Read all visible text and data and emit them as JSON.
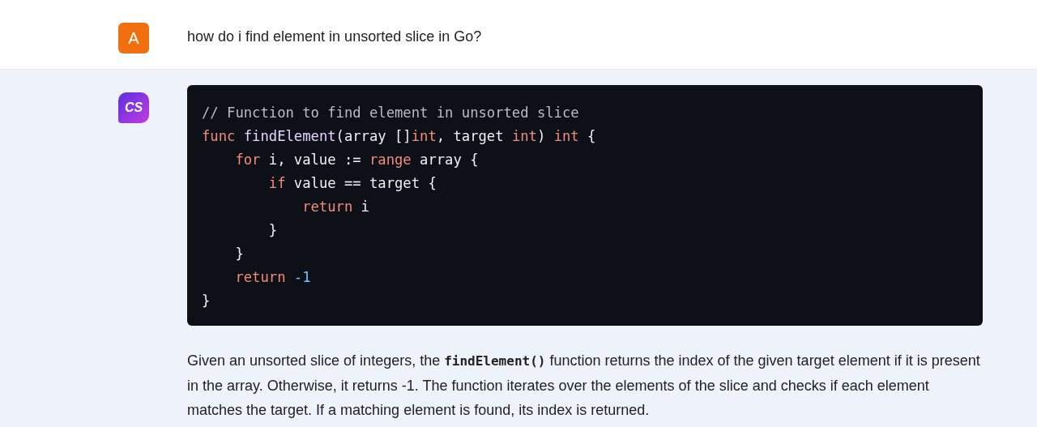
{
  "user_message": {
    "avatar": "A",
    "text": "how do i find element in unsorted slice in Go?"
  },
  "assistant_message": {
    "avatar": "CS",
    "code_lines": [
      [
        {
          "kind": "comment",
          "text": "// Function to find element in unsorted slice"
        }
      ],
      [
        {
          "kind": "keyword",
          "text": "func "
        },
        {
          "kind": "function",
          "text": "findElement"
        },
        {
          "kind": "plain",
          "text": "(array []"
        },
        {
          "kind": "keyword",
          "text": "int"
        },
        {
          "kind": "plain",
          "text": ", target "
        },
        {
          "kind": "keyword",
          "text": "int"
        },
        {
          "kind": "plain",
          "text": ") "
        },
        {
          "kind": "keyword",
          "text": "int"
        },
        {
          "kind": "plain",
          "text": " {"
        }
      ],
      [
        {
          "kind": "keyword",
          "text": "    for"
        },
        {
          "kind": "plain",
          "text": " i, value := "
        },
        {
          "kind": "keyword",
          "text": "range"
        },
        {
          "kind": "plain",
          "text": " array {"
        }
      ],
      [
        {
          "kind": "keyword",
          "text": "        if"
        },
        {
          "kind": "plain",
          "text": " value == target {"
        }
      ],
      [
        {
          "kind": "keyword",
          "text": "            return"
        },
        {
          "kind": "plain",
          "text": " i"
        }
      ],
      [
        {
          "kind": "plain",
          "text": "        }"
        }
      ],
      [
        {
          "kind": "plain",
          "text": "    }"
        }
      ],
      [
        {
          "kind": "keyword",
          "text": "    return "
        },
        {
          "kind": "number",
          "text": "-1"
        }
      ],
      [
        {
          "kind": "plain",
          "text": "}"
        }
      ]
    ],
    "explanation": [
      {
        "kind": "text",
        "text": "Given an unsorted slice of integers, the "
      },
      {
        "kind": "code",
        "text": "findElement()"
      },
      {
        "kind": "text",
        "text": " function returns the index of the given target element if it is present in the array. Otherwise, it returns -1. The function iterates over the elements of the slice and checks if each element matches the target. If a matching element is found, its index is returned."
      }
    ]
  }
}
